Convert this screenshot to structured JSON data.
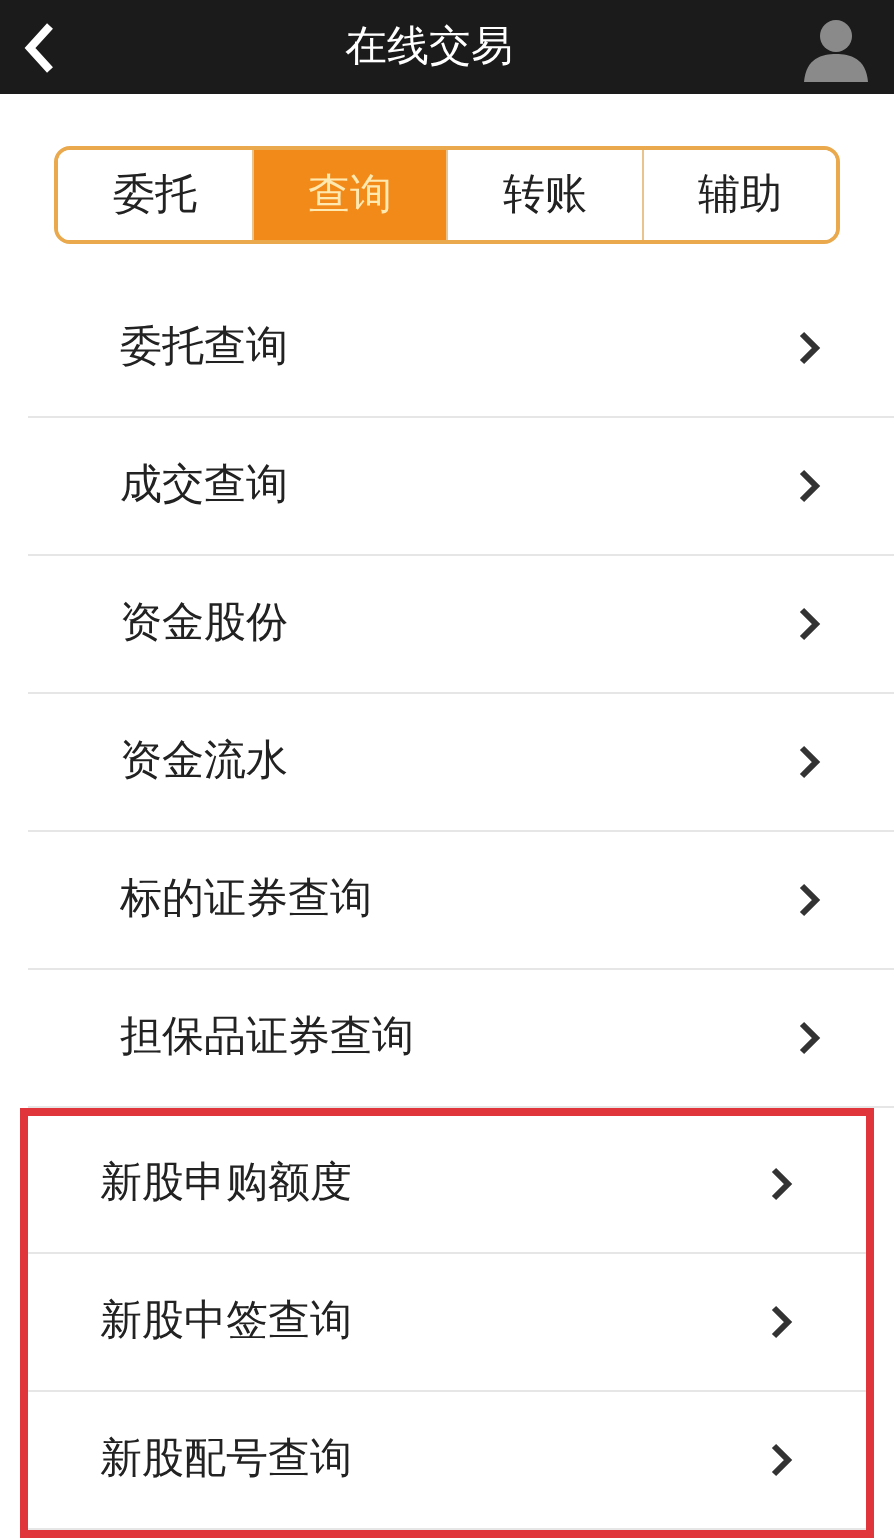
{
  "header": {
    "title": "在线交易"
  },
  "tabs": [
    {
      "label": "委托",
      "selected": false
    },
    {
      "label": "查询",
      "selected": true
    },
    {
      "label": "转账",
      "selected": false
    },
    {
      "label": "辅助",
      "selected": false
    }
  ],
  "items": [
    {
      "label": "委托查询",
      "highlighted": false
    },
    {
      "label": "成交查询",
      "highlighted": false
    },
    {
      "label": "资金股份",
      "highlighted": false
    },
    {
      "label": "资金流水",
      "highlighted": false
    },
    {
      "label": "标的证券查询",
      "highlighted": false
    },
    {
      "label": "担保品证券查询",
      "highlighted": false
    },
    {
      "label": "新股申购额度",
      "highlighted": true
    },
    {
      "label": "新股中签查询",
      "highlighted": true
    },
    {
      "label": "新股配号查询",
      "highlighted": true
    }
  ]
}
